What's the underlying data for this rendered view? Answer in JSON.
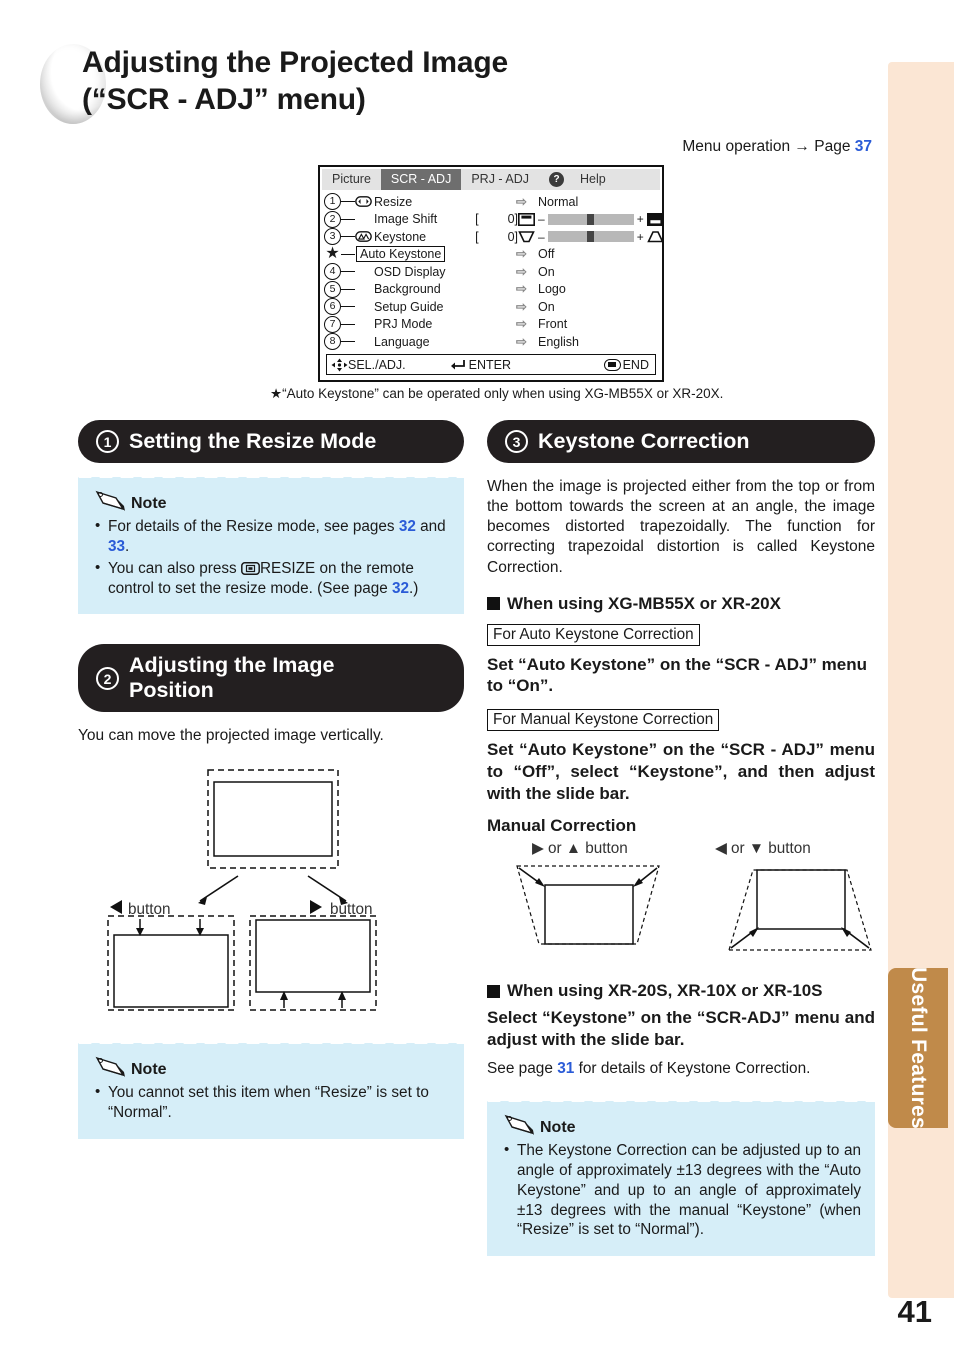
{
  "page": {
    "title_line1": "Adjusting the Projected Image",
    "title_line2": "(“SCR - ADJ” menu)",
    "menu_operation": "Menu operation",
    "menu_operation_arrow": "→",
    "menu_operation_page_label": "Page",
    "menu_operation_page": "37",
    "side_tab": "Useful Features",
    "page_number": "41"
  },
  "osd": {
    "tabs": [
      {
        "label": "Picture",
        "active": false
      },
      {
        "label": "SCR - ADJ",
        "active": true
      },
      {
        "label": "PRJ - ADJ",
        "active": false
      },
      {
        "label": "Help",
        "active": false
      }
    ],
    "help_icon": "?",
    "rows": [
      {
        "num": "1",
        "label": "Resize",
        "value": "Normal",
        "type": "arrow",
        "icon": "resize-icon"
      },
      {
        "num": "2",
        "label": "Image Shift",
        "value": "0",
        "type": "slider",
        "bracket_open": "[",
        "bracket_close": "]",
        "minus": "–",
        "plus": "+",
        "left_icon": "shift-up-icon",
        "right_icon": "shift-down-icon"
      },
      {
        "num": "3",
        "label": "Keystone",
        "value": "0",
        "type": "slider",
        "bracket_open": "[",
        "bracket_close": "]",
        "minus": "–",
        "plus": "+",
        "left_icon": "keystone-down-icon",
        "right_icon": "keystone-up-icon",
        "icon": "keystone-icon"
      },
      {
        "num": "★",
        "label": "Auto Keystone",
        "value": "Off",
        "type": "arrow",
        "boxed": true
      },
      {
        "num": "4",
        "label": "OSD Display",
        "value": "On",
        "type": "arrow"
      },
      {
        "num": "5",
        "label": "Background",
        "value": "Logo",
        "type": "arrow"
      },
      {
        "num": "6",
        "label": "Setup Guide",
        "value": "On",
        "type": "arrow"
      },
      {
        "num": "7",
        "label": "PRJ Mode",
        "value": "Front",
        "type": "arrow"
      },
      {
        "num": "8",
        "label": "Language",
        "value": "English",
        "type": "arrow"
      }
    ],
    "footer": {
      "sel": "SEL./ADJ.",
      "enter": "ENTER",
      "end": "END"
    },
    "footnote": "★“Auto Keystone” can be operated only when using XG-MB55X or XR-20X."
  },
  "section1": {
    "number": "1",
    "heading": "Setting the Resize Mode",
    "note_title": "Note",
    "notes": [
      {
        "pre": "For details of the Resize mode, see pages ",
        "ref1": "32",
        "mid": " and ",
        "ref2": "33",
        "post": "."
      },
      {
        "pre": "You can also press ",
        "icon": "resize-button-icon",
        "mid2": "RESIZE on the remote control to set the resize mode. (See page ",
        "ref1": "32",
        "post": ".)"
      }
    ]
  },
  "section2": {
    "number": "2",
    "heading_line1": "Adjusting the Image",
    "heading_line2": "Position",
    "intro": "You can move the projected image vertically.",
    "left_button_caption": "button",
    "right_button_caption": "button",
    "left_button_glyph": "◀",
    "right_button_glyph": "▶",
    "note_title": "Note",
    "notes": [
      {
        "text": "You cannot set this item when “Resize” is set to “Normal”."
      }
    ]
  },
  "section3": {
    "number": "3",
    "heading": "Keystone Correction",
    "intro": "When the image is projected either from the top or from the bottom towards the screen at an angle, the image becomes distorted trapezoidally. The function for correcting trapezoidal distortion is called Keystone Correction.",
    "sub1": "When using XG-MB55X or XR-20X",
    "boxed1": "For Auto Keystone Correction",
    "stmt1": "Set “Auto Keystone” on the “SCR - ADJ” menu to “On”.",
    "boxed2": "For Manual Keystone Correction",
    "stmt2": "Set “Auto Keystone” on the “SCR - ADJ” menu to “Off”, select “Keystone”, and then adjust with the slide bar.",
    "manual_correction": "Manual Correction",
    "fig_left_caption": "▶ or ▲ button",
    "fig_right_caption": "◀ or ▼ button",
    "sub2": "When using XR-20S, XR-10X or XR-10S",
    "stmt3": "Select “Keystone” on the “SCR-ADJ” menu and adjust with the slide bar.",
    "see_page_pre": "See page ",
    "see_page_ref": "31",
    "see_page_post": " for details of Keystone Correction.",
    "note_title": "Note",
    "notes": [
      {
        "text": "The Keystone Correction can be adjusted up to an angle of approximately ±13 degrees with the “Auto Keystone” and up to an angle of approximately ±13 degrees with the manual “Keystone” (when “Resize” is set to “Normal”)."
      }
    ]
  }
}
